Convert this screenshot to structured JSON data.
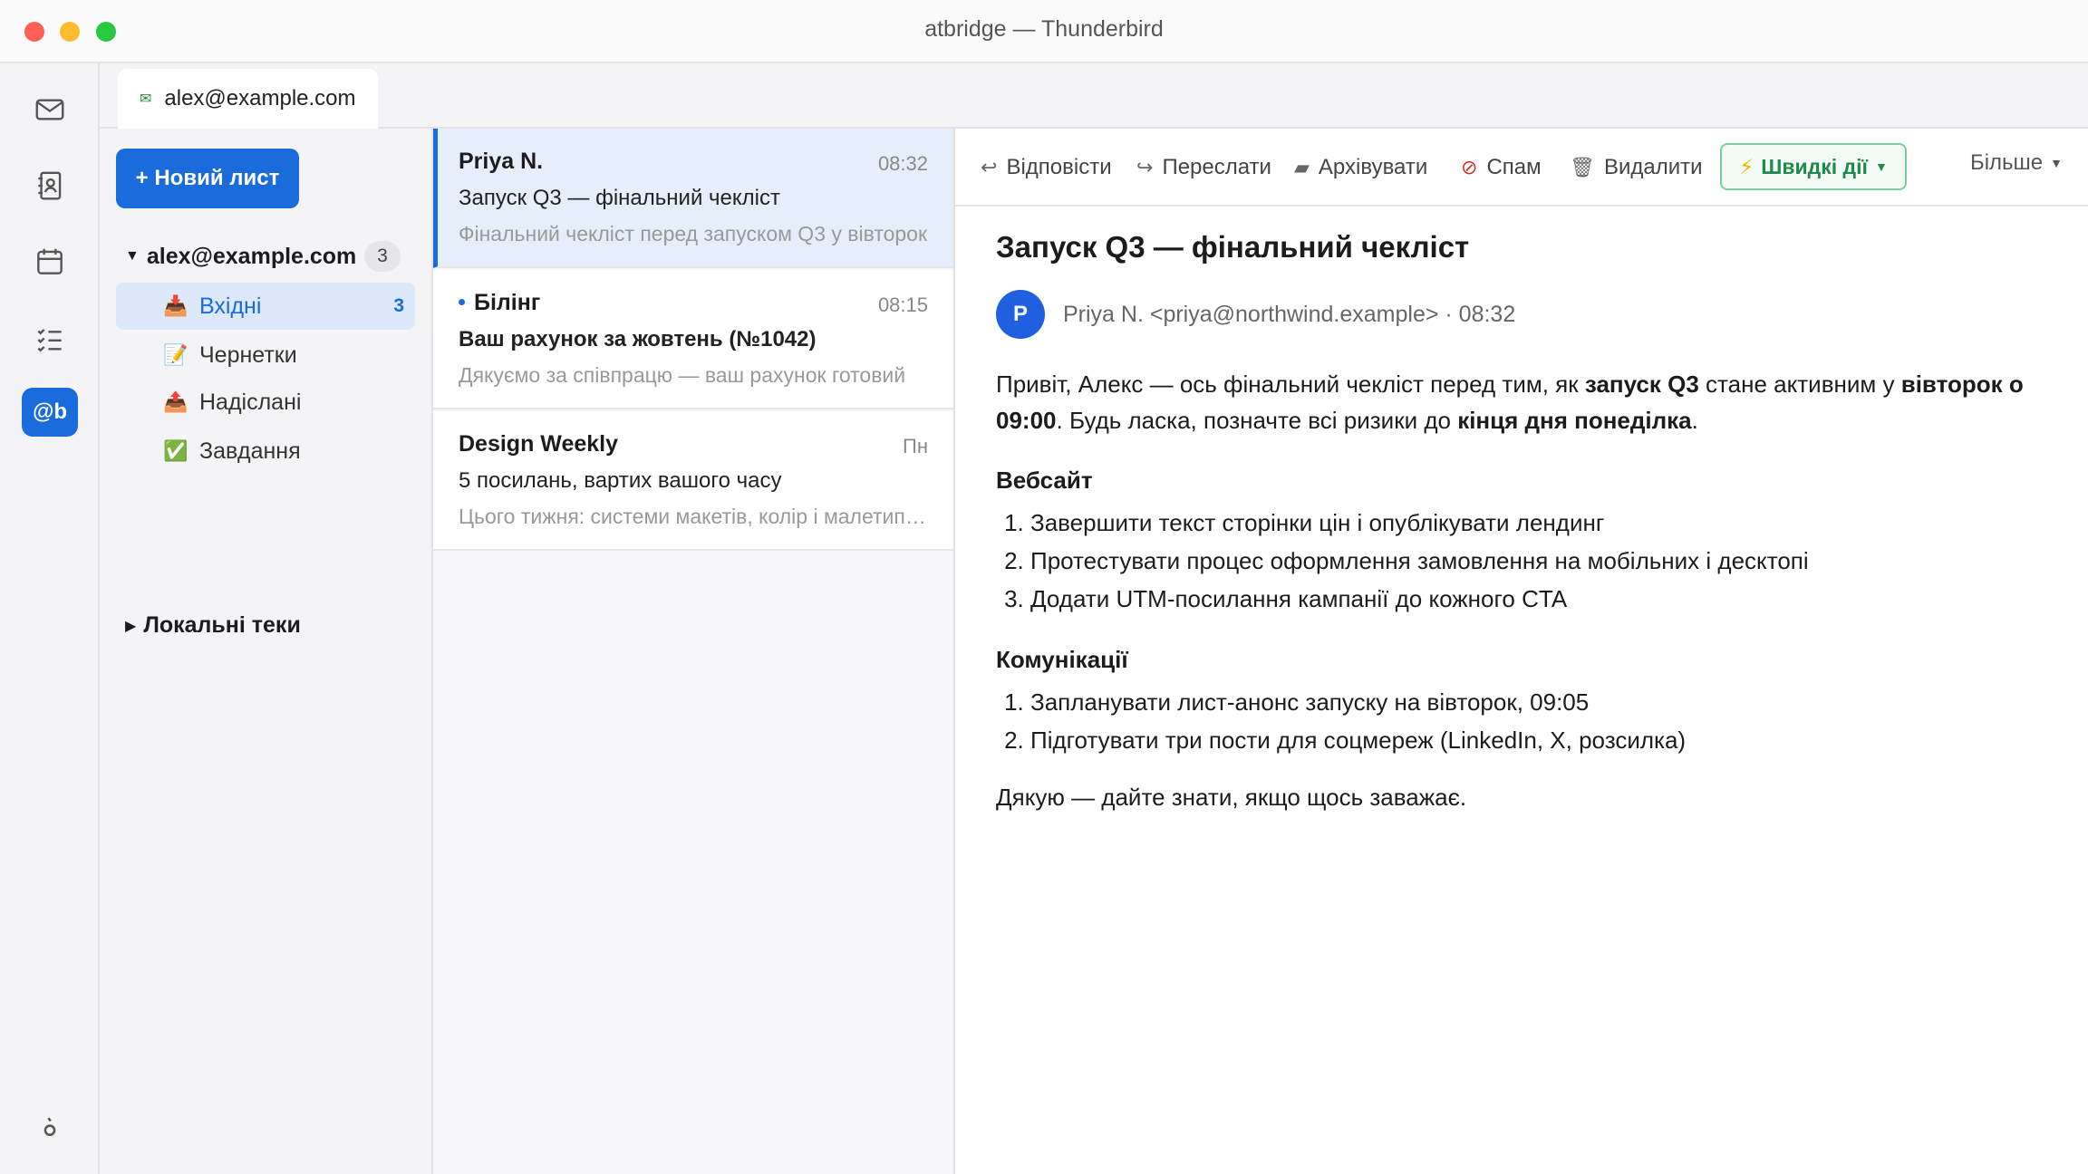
{
  "window": {
    "title": "atbridge — Thunderbird"
  },
  "spaces": {
    "items": [
      {
        "name": "mail-icon"
      },
      {
        "name": "address-book-icon"
      },
      {
        "name": "calendar-icon"
      },
      {
        "name": "tasks-icon"
      },
      {
        "name": "atbridge-icon",
        "label": "@b"
      },
      {
        "name": "settings-icon"
      }
    ]
  },
  "tab": {
    "label": "alex@example.com",
    "icon": "envelope-icon"
  },
  "folders": {
    "new_message": "+ Новий лист",
    "account": {
      "name": "alex@example.com",
      "count": "3"
    },
    "items": [
      {
        "label": "Вхідні",
        "icon": "📥",
        "count": "3"
      },
      {
        "label": "Чернетки",
        "icon": "📝",
        "count": ""
      },
      {
        "label": "Надіслані",
        "icon": "📤",
        "count": ""
      },
      {
        "label": "Завдання",
        "icon": "✅",
        "count": ""
      }
    ],
    "local": "Локальні теки"
  },
  "messages": [
    {
      "sender": "Priya N.",
      "time": "08:32",
      "subject": "Запуск Q3 — фінальний чекліст",
      "preview": "Фінальний чекліст перед запуском Q3 у вівторок",
      "unread": false,
      "selected": true
    },
    {
      "sender": "Білінг",
      "time": "08:15",
      "subject": "Ваш рахунок за жовтень (№1042)",
      "preview": "Дякуємо за співпрацю — ваш рахунок готовий",
      "unread": true,
      "selected": false
    },
    {
      "sender": "Design Weekly",
      "time": "Пн",
      "subject": "5 посилань, вартих вашого часу",
      "preview": "Цього тижня: системи макетів, колір і малетипографіка",
      "unread": false,
      "selected": false
    }
  ],
  "toolbar": {
    "reply": "Відповісти",
    "forward": "Переслати",
    "archive": "Архівувати",
    "spam": "Спам",
    "delete": "Видалити",
    "quick_actions": "Швидкі дії",
    "more": "Більше"
  },
  "reader": {
    "subject": "Запуск Q3 — фінальний чекліст",
    "avatar_letter": "P",
    "from": "Priya N. <priya@northwind.example> · 08:32",
    "greeting_a": "Привіт, Алекс — ось фінальний чекліст перед тим, як ",
    "greeting_b": "запуск Q3",
    "greeting_c": " стане активним у ",
    "greeting_d": "вівторок о 09:00",
    "greeting_e": ". Будь ласка, позначте всі ризики до ",
    "greeting_f": "кінця дня понеділка",
    "greeting_g": ".",
    "section1": "Вебсайт",
    "section1_items": [
      "Завершити текст сторінки цін і опублікувати лендинг",
      "Протестувати процес оформлення замовлення на мобільних і десктопі",
      "Додати UTM-посилання кампанії до кожного CTA"
    ],
    "section2": "Комунікації",
    "section2_items": [
      "Запланувати лист-анонс запуску на вівторок, 09:05",
      "Підготувати три пости для соцмереж (LinkedIn, X, розсилка)"
    ],
    "closing": "Дякую — дайте знати, якщо щось заважає."
  },
  "colors": {
    "accent": "#1a6bdc",
    "quick": "#1f8a4c"
  }
}
